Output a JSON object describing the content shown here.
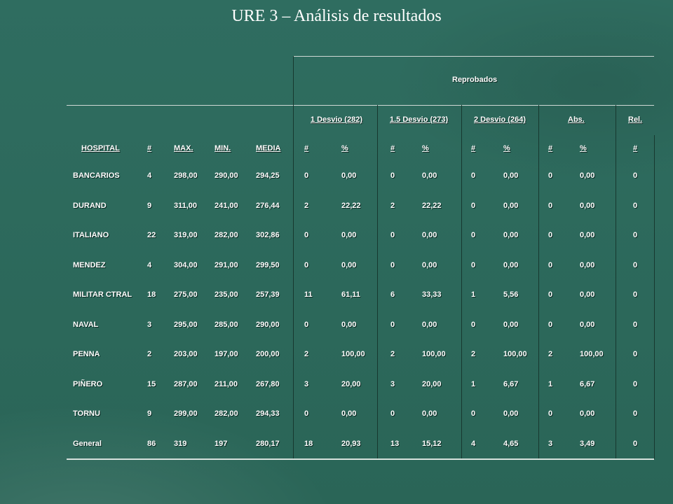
{
  "title": "URE 3 – Análisis de resultados",
  "table": {
    "group_header": "Reprobados",
    "desvio_headers": [
      "1 Desvio (282)",
      "1.5 Desvio (273)",
      "2 Desvio (264)",
      "Abs.",
      "Rel."
    ],
    "columns": [
      "HOSPITAL",
      "#",
      "MAX.",
      "MIN.",
      "MEDIA",
      "#",
      "%",
      "#",
      "%",
      "#",
      "%",
      "#",
      "%",
      "#"
    ],
    "rows": [
      [
        "BANCARIOS",
        "4",
        "298,00",
        "290,00",
        "294,25",
        "0",
        "0,00",
        "0",
        "0,00",
        "0",
        "0,00",
        "0",
        "0,00",
        "0"
      ],
      [
        "DURAND",
        "9",
        "311,00",
        "241,00",
        "276,44",
        "2",
        "22,22",
        "2",
        "22,22",
        "0",
        "0,00",
        "0",
        "0,00",
        "0"
      ],
      [
        "ITALIANO",
        "22",
        "319,00",
        "282,00",
        "302,86",
        "0",
        "0,00",
        "0",
        "0,00",
        "0",
        "0,00",
        "0",
        "0,00",
        "0"
      ],
      [
        "MENDEZ",
        "4",
        "304,00",
        "291,00",
        "299,50",
        "0",
        "0,00",
        "0",
        "0,00",
        "0",
        "0,00",
        "0",
        "0,00",
        "0"
      ],
      [
        "MILITAR CTRAL",
        "18",
        "275,00",
        "235,00",
        "257,39",
        "11",
        "61,11",
        "6",
        "33,33",
        "1",
        "5,56",
        "0",
        "0,00",
        "0"
      ],
      [
        "NAVAL",
        "3",
        "295,00",
        "285,00",
        "290,00",
        "0",
        "0,00",
        "0",
        "0,00",
        "0",
        "0,00",
        "0",
        "0,00",
        "0"
      ],
      [
        "PENNA",
        "2",
        "203,00",
        "197,00",
        "200,00",
        "2",
        "100,00",
        "2",
        "100,00",
        "2",
        "100,00",
        "2",
        "100,00",
        "0"
      ],
      [
        "PIÑERO",
        "15",
        "287,00",
        "211,00",
        "267,80",
        "3",
        "20,00",
        "3",
        "20,00",
        "1",
        "6,67",
        "1",
        "6,67",
        "0"
      ],
      [
        "TORNU",
        "9",
        "299,00",
        "282,00",
        "294,33",
        "0",
        "0,00",
        "0",
        "0,00",
        "0",
        "0,00",
        "0",
        "0,00",
        "0"
      ],
      [
        "General",
        "86",
        "319",
        "197",
        "280,17",
        "18",
        "20,93",
        "13",
        "15,12",
        "4",
        "4,65",
        "3",
        "3,49",
        "0"
      ]
    ]
  }
}
